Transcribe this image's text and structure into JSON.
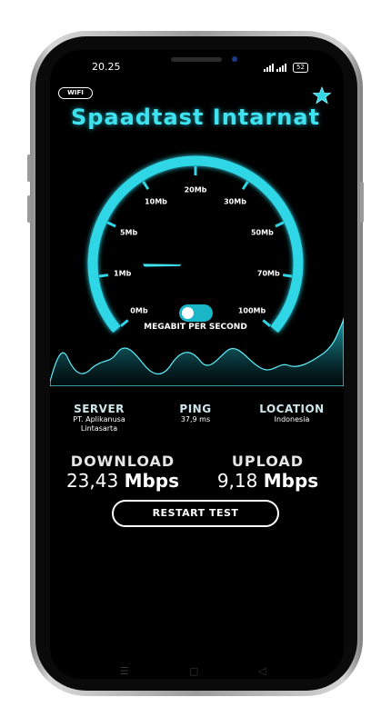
{
  "status_bar": {
    "time": "20.25",
    "battery": "52"
  },
  "badge": "WIFI",
  "title": "Spaadtast Intarnat",
  "gauge": {
    "ticks": [
      "0Mb",
      "1Mb",
      "5Mb",
      "10Mb",
      "20Mb",
      "30Mb",
      "50Mb",
      "70Mb",
      "100Mb"
    ],
    "unit_label": "MEGABIT PER SECOND",
    "needle_position": 0.15
  },
  "stats": {
    "server": {
      "label": "SERVER",
      "value_line1": "PT. Aplikanusa",
      "value_line2": "Lintasarta"
    },
    "ping": {
      "label": "PING",
      "value": "37,9 ms"
    },
    "location": {
      "label": "LOCATION",
      "value": "Indonesia"
    }
  },
  "results": {
    "download": {
      "label": "DOWNLOAD",
      "value": "23,43",
      "unit": "Mbps"
    },
    "upload": {
      "label": "UPLOAD",
      "value": "9,18",
      "unit": "Mbps"
    }
  },
  "restart_label": "RESTART TEST",
  "colors": {
    "accent": "#3fe3f0",
    "wave": "#1a8e98",
    "background": "#000000"
  },
  "icons": [
    "settings-star-icon",
    "signal-icon",
    "battery-icon",
    "nav-menu-icon",
    "nav-home-icon",
    "nav-back-icon"
  ]
}
